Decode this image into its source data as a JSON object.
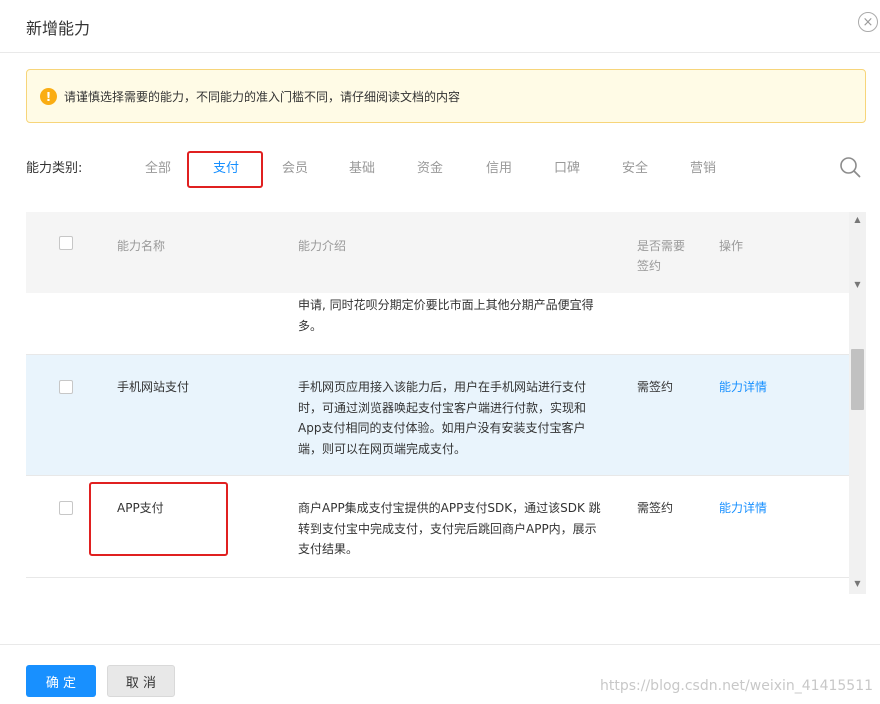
{
  "dialog": {
    "title": "新增能力",
    "close_glyph": "×"
  },
  "alert": {
    "icon_glyph": "!",
    "icon_name": "warning-icon",
    "text": "请谨慎选择需要的能力，不同能力的准入门槛不同，请仔细阅读文档的内容"
  },
  "categories": {
    "label": "能力类别:",
    "tabs": [
      "全部",
      "支付",
      "会员",
      "基础",
      "资金",
      "信用",
      "口碑",
      "安全",
      "营销"
    ],
    "active": "支付"
  },
  "table": {
    "headers": {
      "name": "能力名称",
      "desc": "能力介绍",
      "sign": "是否需要签约",
      "action": "操作"
    },
    "partial_row": {
      "desc": "申请, 同时花呗分期定价要比市面上其他分期产品便宜得多。"
    },
    "rows": [
      {
        "name": "手机网站支付",
        "desc": "手机网页应用接入该能力后，用户在手机网站进行支付时，可通过浏览器唤起支付宝客户端进行付款，实现和App支付相同的支付体验。如用户没有安装支付宝客户端，则可以在网页端完成支付。",
        "sign": "需签约",
        "action": "能力详情"
      },
      {
        "name": "APP支付",
        "desc": "商户APP集成支付宝提供的APP支付SDK，通过该SDK 跳转到支付宝中完成支付，支付完后跳回商户APP内，展示支付结果。",
        "sign": "需签约",
        "action": "能力详情"
      }
    ]
  },
  "footer": {
    "ok": "确 定",
    "cancel": "取 消"
  },
  "watermark": "https://blog.csdn.net/weixin_41415511",
  "colors": {
    "primary": "#1890ff",
    "highlight_box": "#e02020",
    "alert_bg": "#fffbe6",
    "alert_icon": "#faad14",
    "row_hover": "#e9f4fc"
  }
}
